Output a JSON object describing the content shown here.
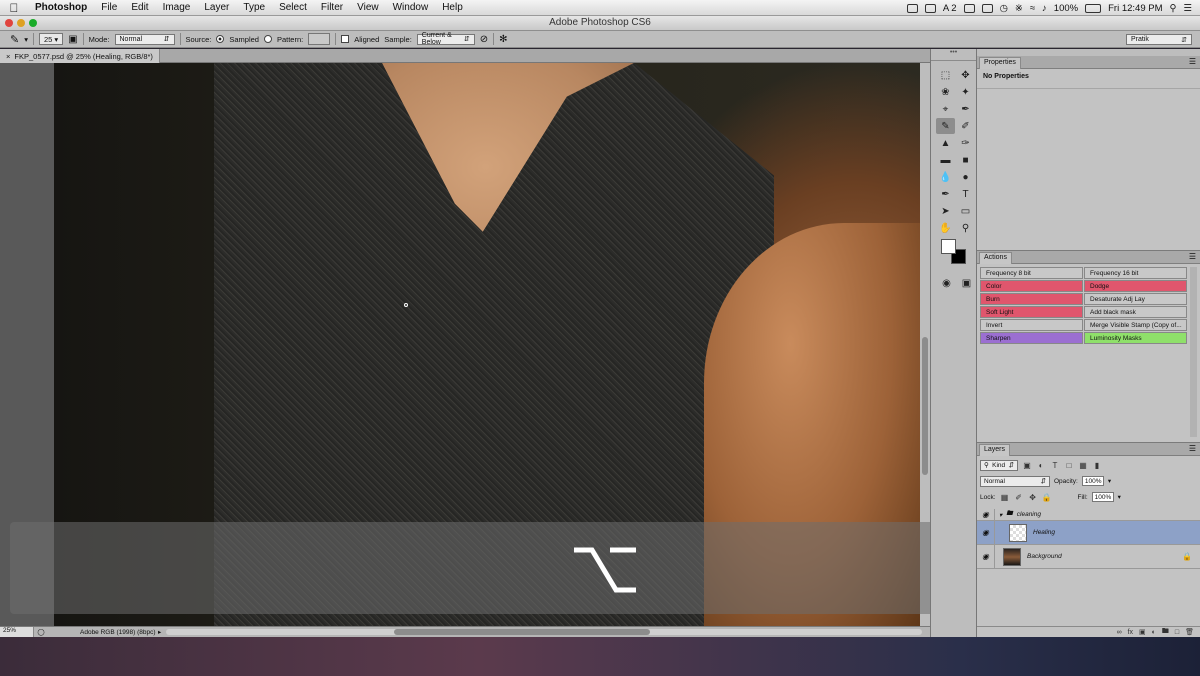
{
  "menubar": {
    "app": "Photoshop",
    "items": [
      "File",
      "Edit",
      "Image",
      "Layer",
      "Type",
      "Select",
      "Filter",
      "View",
      "Window",
      "Help"
    ],
    "status": {
      "badge": "A 2",
      "battery": "100%",
      "clock": "Fri 12:49 PM"
    }
  },
  "window": {
    "title": "Adobe Photoshop CS6"
  },
  "options": {
    "brush_size": "25",
    "mode_label": "Mode:",
    "mode_value": "Normal",
    "source_label": "Source:",
    "sampled_label": "Sampled",
    "pattern_label": "Pattern:",
    "aligned_label": "Aligned",
    "sample_label": "Sample:",
    "sample_value": "Current & Below",
    "workspace": "Pratik"
  },
  "document": {
    "tab_label": "FKP_0577.psd @ 25% (Healing, RGB/8*)",
    "zoom": "25%",
    "profile": "Adobe RGB (1998) (8bpc)"
  },
  "overlay": {
    "key_symbol": "option-key"
  },
  "properties": {
    "title": "Properties",
    "body": "No Properties"
  },
  "actions": {
    "title": "Actions",
    "buttons": [
      {
        "label": "Frequency 8 bit",
        "color": "#c8c8c8"
      },
      {
        "label": "Frequency 16 bit",
        "color": "#c8c8c8"
      },
      {
        "label": "Color",
        "color": "#e0566d"
      },
      {
        "label": "Dodge",
        "color": "#e0566d"
      },
      {
        "label": "Burn",
        "color": "#e0566d"
      },
      {
        "label": "Desaturate Adj Lay",
        "color": "#c8c8c8"
      },
      {
        "label": "Soft Light",
        "color": "#e0566d"
      },
      {
        "label": "Add black mask",
        "color": "#c8c8c8"
      },
      {
        "label": "Invert",
        "color": "#c8c8c8"
      },
      {
        "label": "Merge Visible Stamp (Copy of...",
        "color": "#c8c8c8"
      },
      {
        "label": "Sharpen",
        "color": "#9b6fd1"
      },
      {
        "label": "Luminosity Masks",
        "color": "#8fe06a"
      }
    ]
  },
  "layers": {
    "title": "Layers",
    "kind_filter": "Kind",
    "blend_mode": "Normal",
    "opacity_label": "Opacity:",
    "opacity_value": "100%",
    "lock_label": "Lock:",
    "fill_label": "Fill:",
    "fill_value": "100%",
    "items": [
      {
        "name": "cleaning",
        "type": "group"
      },
      {
        "name": "Healing",
        "type": "layer",
        "selected": true
      },
      {
        "name": "Background",
        "type": "layer",
        "locked": true
      }
    ]
  }
}
